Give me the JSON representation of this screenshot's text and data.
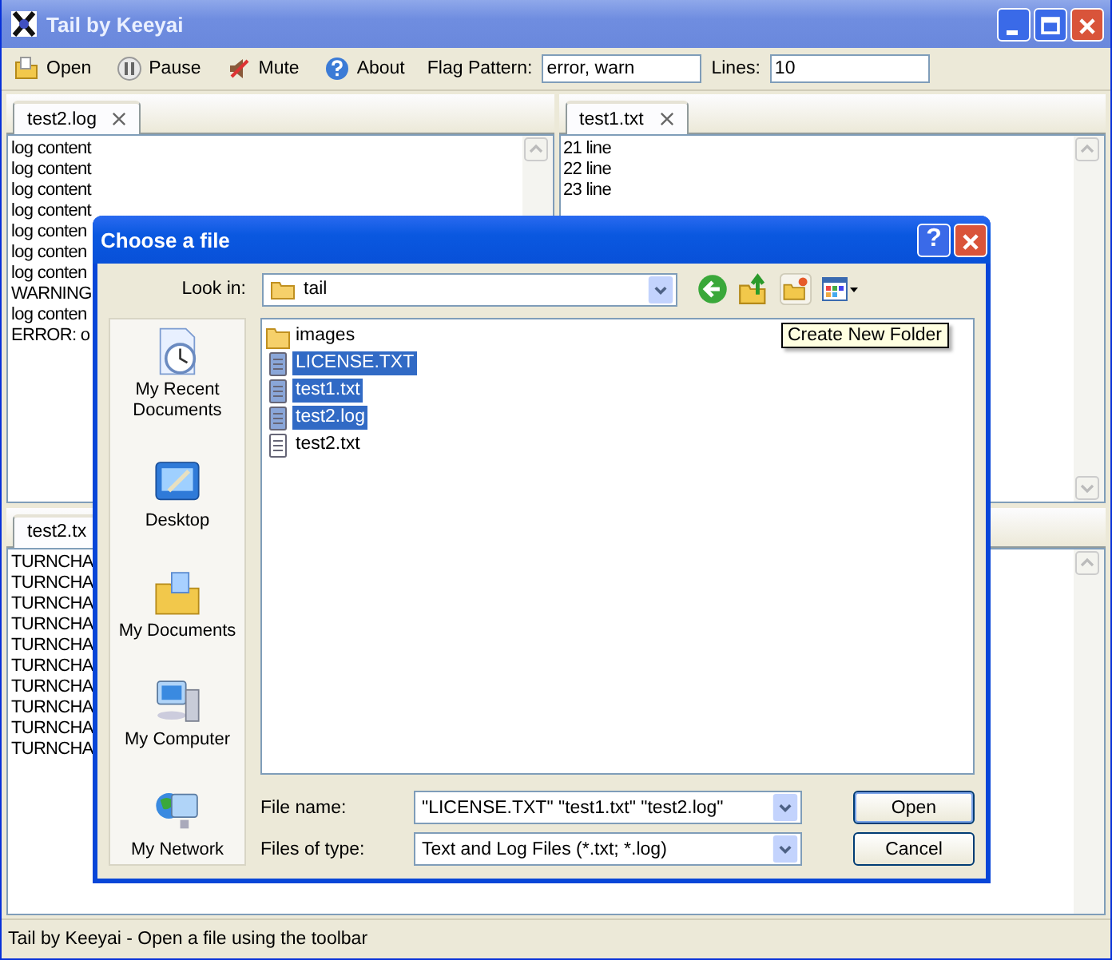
{
  "window": {
    "title": "Tail by Keeyai"
  },
  "toolbar": {
    "buttons": [
      {
        "label": "Open",
        "kind": "open"
      },
      {
        "label": "Pause",
        "kind": "pause"
      },
      {
        "label": "Mute",
        "kind": "mute"
      },
      {
        "label": "About",
        "kind": "about"
      }
    ],
    "flag_pattern": {
      "label": "Flag Pattern:",
      "value": "error, warn"
    },
    "lines": {
      "label": "Lines:",
      "value": "10"
    }
  },
  "panes": [
    {
      "tab": "test2.log",
      "lines": [
        "log content",
        "log content",
        "log content",
        "log content",
        "log conten",
        "log conten",
        "log conten",
        "WARNING",
        "log conten",
        "ERROR: o"
      ]
    },
    {
      "tab": "test1.txt",
      "lines": [
        "21 line",
        "22 line",
        "23 line"
      ]
    },
    {
      "tab": "test2.tx",
      "lines": [
        "TURNCHA",
        "TURNCHA",
        "TURNCHA",
        "TURNCHA",
        "TURNCHA",
        "TURNCHA",
        "TURNCHA",
        "TURNCHA",
        "TURNCHA",
        "TURNCHA"
      ]
    }
  ],
  "dialog": {
    "title": "Choose a file",
    "look_in": {
      "label": "Look in:",
      "value": "tail"
    },
    "places": [
      {
        "label": "My Recent Documents",
        "kind": "recent"
      },
      {
        "label": "Desktop",
        "kind": "desktop"
      },
      {
        "label": "My Documents",
        "kind": "documents"
      },
      {
        "label": "My Computer",
        "kind": "computer"
      },
      {
        "label": "My Network",
        "kind": "network"
      }
    ],
    "files": [
      {
        "name": "images",
        "kind": "folder",
        "selected": false
      },
      {
        "name": "LICENSE.TXT",
        "kind": "file",
        "selected": true
      },
      {
        "name": "test1.txt",
        "kind": "file",
        "selected": true
      },
      {
        "name": "test2.log",
        "kind": "file",
        "selected": true
      },
      {
        "name": "test2.txt",
        "kind": "file",
        "selected": false
      }
    ],
    "help_button": "?",
    "tooltip": "Create New Folder",
    "file_name": {
      "label": "File name:",
      "value": "\"LICENSE.TXT\" \"test1.txt\" \"test2.log\""
    },
    "file_type": {
      "label": "Files of type:",
      "value": "Text and Log Files (*.txt; *.log)"
    },
    "buttons": [
      {
        "label": "Open",
        "default": true
      },
      {
        "label": "Cancel",
        "default": false
      }
    ]
  },
  "status_bar": "Tail by Keeyai - Open a file using the toolbar"
}
